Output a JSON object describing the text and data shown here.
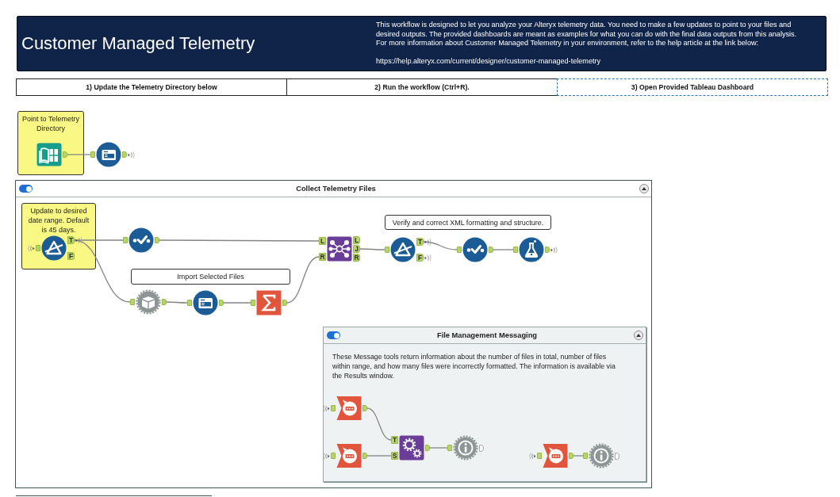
{
  "header": {
    "title": "Customer Managed Telemetry",
    "description": "This workflow is designed to let you analyze your Alteryx telemetry data. You need to make a few updates to point to your files and desired outputs. The provided dashboards are meant as examples for what you can do with the final data outputs from this analysis. For more information about Customer Managed Telemetry in your environment, refer to the help article at the link below:",
    "link": "https://help.alteryx.com/current/designer/customer-managed-telemetry"
  },
  "steps": [
    {
      "label": "1) Update the Telemetry Directory below",
      "selected": false
    },
    {
      "label": "2) Run the workflow (Ctrl+R).",
      "selected": false
    },
    {
      "label": "3) Open Provided Tableau Dashboard",
      "selected": true
    }
  ],
  "canvas": {
    "comments": [
      {
        "kind": "note",
        "text": "Point to Telemetry Directory"
      }
    ],
    "tools": [
      {
        "kind": "directory",
        "outputs": [
          {
            "wireless": false
          }
        ]
      },
      {
        "kind": "input",
        "inputs": [
          {
            "wireless": false
          }
        ],
        "outputs": [
          {
            "wireless": true
          }
        ]
      }
    ],
    "containers": [
      {
        "title": "Collect Telemetry Files",
        "enabled": true,
        "comments": [
          {
            "kind": "note",
            "text": "Update to desired date range. Default is 45 days."
          },
          {
            "kind": "label",
            "text": "Import Selected Files"
          },
          {
            "kind": "label",
            "text": "Verify and correct XML formatting and structure."
          }
        ],
        "tools": [
          {
            "kind": "filter",
            "inputs": [
              {
                "wireless": true
              }
            ],
            "outputs": [
              {
                "label": "T",
                "wireless": true
              },
              {
                "label": "F",
                "wireless": false
              }
            ]
          },
          {
            "kind": "select",
            "inputs": [
              {
                "wireless": false
              }
            ],
            "outputs": [
              {
                "wireless": false
              }
            ]
          },
          {
            "kind": "join",
            "inputs": [
              {
                "label": "L",
                "wireless": false
              },
              {
                "label": "R",
                "wireless": false
              }
            ],
            "outputs": [
              {
                "label": "L",
                "wireless": false
              },
              {
                "label": "J",
                "wireless": false
              },
              {
                "label": "R",
                "wireless": false
              }
            ]
          },
          {
            "kind": "dynamic_input",
            "inputs": [
              {
                "wireless": false
              }
            ],
            "outputs": [
              {
                "wireless": false
              }
            ]
          },
          {
            "kind": "input",
            "inputs": [
              {
                "wireless": false
              }
            ],
            "outputs": [
              {
                "wireless": false
              }
            ]
          },
          {
            "kind": "summarize",
            "inputs": [
              {
                "wireless": false
              }
            ],
            "outputs": [
              {
                "wireless": false
              }
            ]
          },
          {
            "kind": "filter",
            "inputs": [
              {
                "wireless": false
              }
            ],
            "outputs": [
              {
                "label": "T",
                "wireless": true
              },
              {
                "label": "F",
                "wireless": true
              }
            ]
          },
          {
            "kind": "select",
            "inputs": [
              {
                "wireless": false
              }
            ],
            "outputs": [
              {
                "wireless": false
              }
            ]
          },
          {
            "kind": "formula",
            "inputs": [
              {
                "wireless": false
              }
            ],
            "outputs": [
              {
                "wireless": true
              }
            ]
          }
        ]
      },
      {
        "title": "File Management Messaging",
        "enabled": true,
        "description": "These Message tools return information about the number of files in total, number of files within range, and how many files were incorrectly formatted. The information is available via the Results window.",
        "tools": [
          {
            "kind": "message",
            "inputs": [
              {
                "wireless": true
              }
            ],
            "outputs": [
              {
                "wireless": false
              }
            ]
          },
          {
            "kind": "message",
            "inputs": [
              {
                "wireless": true
              }
            ],
            "outputs": [
              {
                "wireless": false
              }
            ]
          },
          {
            "kind": "gears",
            "inputs": [
              {
                "label": "T",
                "wireless": false
              },
              {
                "label": "S",
                "wireless": false
              }
            ],
            "outputs": [
              {
                "wireless": false
              }
            ]
          },
          {
            "kind": "browse",
            "inputs": [
              {
                "wireless": false
              }
            ],
            "outputs": [
              {
                "wireless": false
              }
            ]
          },
          {
            "kind": "message",
            "inputs": [
              {
                "wireless": true
              }
            ],
            "outputs": [
              {
                "wireless": false
              }
            ]
          },
          {
            "kind": "browse",
            "inputs": [
              {
                "wireless": false
              }
            ],
            "outputs": [
              {
                "wireless": false
              }
            ]
          }
        ]
      }
    ]
  }
}
